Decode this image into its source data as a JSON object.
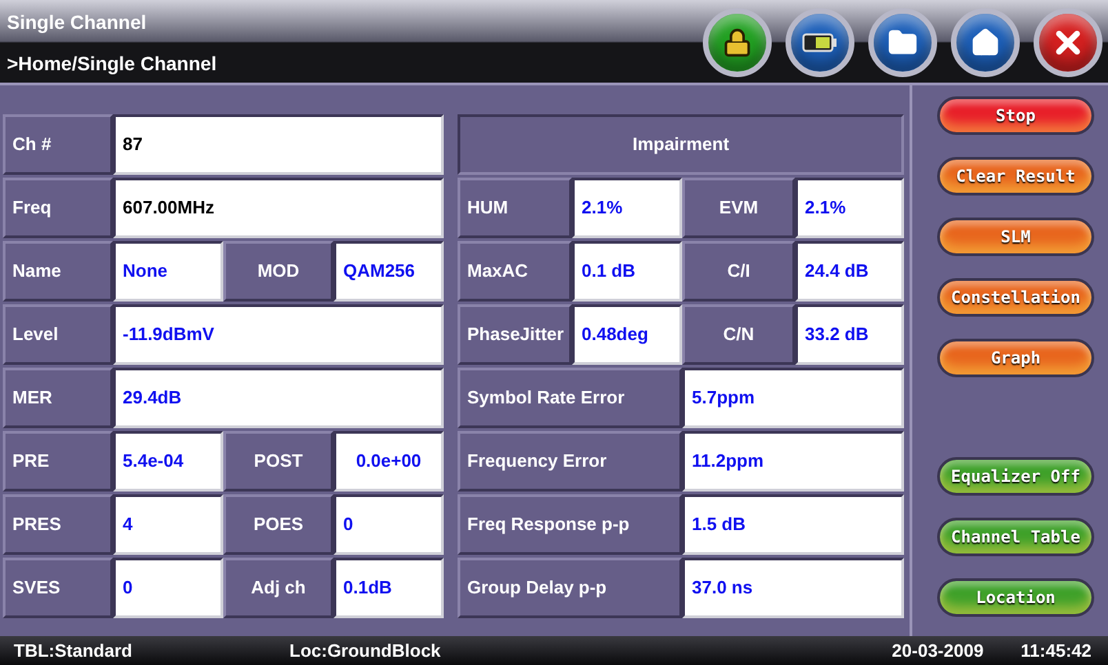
{
  "window": {
    "title": "Single Channel",
    "breadcrumb": ">Home/Single Channel"
  },
  "toolbar": [
    {
      "kind": "lock",
      "color": "#22a022"
    },
    {
      "kind": "battery",
      "color": "#1d5fb8"
    },
    {
      "kind": "folder",
      "color": "#1d5fb8"
    },
    {
      "kind": "home",
      "color": "#1d5fb8"
    },
    {
      "kind": "close",
      "color": "#d42020"
    }
  ],
  "channel_table": [
    [
      {
        "kind": "label",
        "text": "Ch #"
      },
      {
        "kind": "plain",
        "text": "87"
      }
    ],
    [
      {
        "kind": "label",
        "text": "Freq"
      },
      {
        "kind": "plain",
        "text": "607.00MHz"
      }
    ],
    [
      {
        "kind": "label",
        "text": "Name"
      },
      {
        "kind": "value",
        "text": "None"
      },
      {
        "kind": "label",
        "text": "MOD"
      },
      {
        "kind": "value",
        "text": "QAM256"
      }
    ],
    [
      {
        "kind": "label",
        "text": "Level"
      },
      {
        "kind": "value",
        "text": "-11.9dBmV"
      }
    ],
    [
      {
        "kind": "label",
        "text": "MER"
      },
      {
        "kind": "value",
        "text": "29.4dB"
      }
    ],
    [
      {
        "kind": "label",
        "text": "PRE"
      },
      {
        "kind": "value",
        "text": "5.4e-04"
      },
      {
        "kind": "label",
        "text": "POST"
      },
      {
        "kind": "value",
        "text": "0.0e+00"
      }
    ],
    [
      {
        "kind": "label",
        "text": "PRES"
      },
      {
        "kind": "value",
        "text": "4"
      },
      {
        "kind": "label",
        "text": "POES"
      },
      {
        "kind": "value",
        "text": "0"
      }
    ],
    [
      {
        "kind": "label",
        "text": "SVES"
      },
      {
        "kind": "value",
        "text": "0"
      },
      {
        "kind": "label",
        "text": "Adj ch"
      },
      {
        "kind": "value",
        "text": "0.1dB"
      }
    ]
  ],
  "impairment": {
    "title": "Impairment",
    "rows": [
      [
        {
          "kind": "label",
          "text": "HUM"
        },
        {
          "kind": "value",
          "text": "2.1%"
        },
        {
          "kind": "label",
          "text": "EVM"
        },
        {
          "kind": "value",
          "text": "2.1%"
        }
      ],
      [
        {
          "kind": "label",
          "text": "MaxAC"
        },
        {
          "kind": "value",
          "text": "0.1 dB"
        },
        {
          "kind": "label",
          "text": "C/I"
        },
        {
          "kind": "value",
          "text": "24.4 dB"
        }
      ],
      [
        {
          "kind": "label",
          "text": "PhaseJitter"
        },
        {
          "kind": "value",
          "text": "0.48deg"
        },
        {
          "kind": "label",
          "text": "C/N"
        },
        {
          "kind": "value",
          "text": "33.2 dB"
        }
      ],
      [
        {
          "kind": "label",
          "text": "Symbol Rate Error"
        },
        {
          "kind": "value",
          "text": "5.7ppm"
        }
      ],
      [
        {
          "kind": "label",
          "text": "Frequency Error"
        },
        {
          "kind": "value",
          "text": "11.2ppm"
        }
      ],
      [
        {
          "kind": "label",
          "text": "Freq Response p-p"
        },
        {
          "kind": "value",
          "text": "1.5 dB"
        }
      ],
      [
        {
          "kind": "label",
          "text": "Group Delay p-p"
        },
        {
          "kind": "value",
          "text": "37.0 ns"
        }
      ]
    ]
  },
  "buttons_top": [
    {
      "label": "Stop",
      "color": "#e8202a"
    },
    {
      "label": "Clear Result",
      "color": "#e8661e"
    },
    {
      "label": "SLM",
      "color": "#e8661e"
    },
    {
      "label": "Constellation",
      "color": "#e8661e"
    },
    {
      "label": "Graph",
      "color": "#e8661e"
    }
  ],
  "buttons_bottom": [
    {
      "label": "Equalizer Off",
      "color": "#3fa12a"
    },
    {
      "label": "Channel Table",
      "color": "#3fa12a"
    },
    {
      "label": "Location",
      "color": "#3fa12a"
    }
  ],
  "status_bar": [
    "TBL:Standard",
    "Loc:GroundBlock",
    "20-03-2009",
    "11:45:42"
  ]
}
